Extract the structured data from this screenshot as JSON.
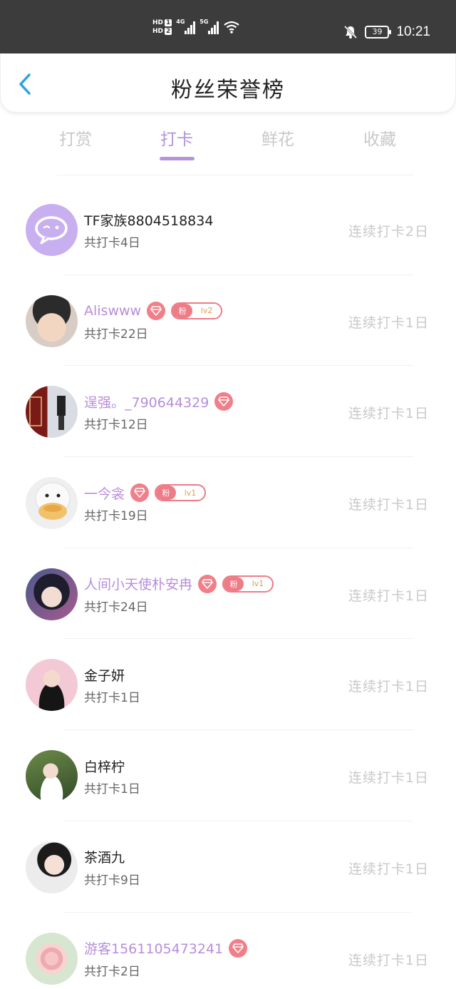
{
  "status_bar": {
    "hd1": "HD",
    "hd1_sim": "1",
    "hd2": "HD",
    "hd2_sim": "2",
    "net1": "4G",
    "net2": "5G",
    "battery": "39",
    "time": "10:21"
  },
  "header": {
    "title": "粉丝荣誉榜"
  },
  "tabs": [
    {
      "label": "打赏"
    },
    {
      "label": "打卡"
    },
    {
      "label": "鲜花"
    },
    {
      "label": "收藏"
    }
  ],
  "active_tab": "打卡",
  "colors": {
    "accent": "#b395d8",
    "diamond": "#f17f89",
    "fan_badge": "#ee7c86"
  },
  "fans": [
    {
      "name": "TF家族8804518834",
      "total": "共打卡4日",
      "streak": "连续打卡2日"
    },
    {
      "name": "Aliswww",
      "total": "共打卡22日",
      "streak": "连续打卡1日",
      "fan_badge": "粉",
      "level": "lv2"
    },
    {
      "name": "逞强。_790644329",
      "total": "共打卡12日",
      "streak": "连续打卡1日"
    },
    {
      "name": "一今衾",
      "total": "共打卡19日",
      "streak": "连续打卡1日",
      "fan_badge": "粉",
      "level": "lv1"
    },
    {
      "name": "人间小天使朴安冉",
      "total": "共打卡24日",
      "streak": "连续打卡1日",
      "fan_badge": "粉",
      "level": "lv1"
    },
    {
      "name": "金子妍",
      "total": "共打卡1日",
      "streak": "连续打卡1日"
    },
    {
      "name": "白梓柠",
      "total": "共打卡1日",
      "streak": "连续打卡1日"
    },
    {
      "name": "茶酒九",
      "total": "共打卡9日",
      "streak": "连续打卡1日"
    },
    {
      "name": "游客1561105473241",
      "total": "共打卡2日",
      "streak": "连续打卡1日"
    }
  ]
}
